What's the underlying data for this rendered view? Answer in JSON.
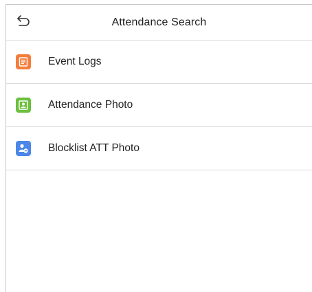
{
  "header": {
    "title": "Attendance Search",
    "back_icon": "back-arrow-icon"
  },
  "menu": {
    "items": [
      {
        "label": "Event Logs",
        "icon": "document-icon",
        "color": "#f47d3c"
      },
      {
        "label": "Attendance Photo",
        "icon": "photo-portrait-icon",
        "color": "#6cbf3f"
      },
      {
        "label": "Blocklist ATT Photo",
        "icon": "user-block-icon",
        "color": "#4b86e8"
      }
    ]
  },
  "colors": {
    "divider": "#dcdcdc",
    "background": "#ffffff"
  }
}
